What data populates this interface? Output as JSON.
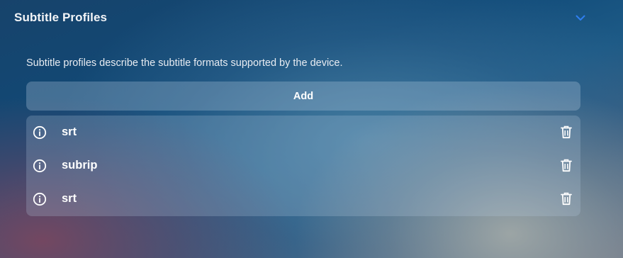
{
  "section": {
    "title": "Subtitle Profiles",
    "expand_icon": "chevron-down-icon",
    "accent_color": "#2f7ff0"
  },
  "description": "Subtitle profiles describe the subtitle formats supported by the device.",
  "add_button": {
    "label": "Add"
  },
  "profiles": [
    {
      "name": "srt",
      "info_icon": "info-icon",
      "delete_icon": "trash-icon"
    },
    {
      "name": "subrip",
      "info_icon": "info-icon",
      "delete_icon": "trash-icon"
    },
    {
      "name": "srt",
      "info_icon": "info-icon",
      "delete_icon": "trash-icon"
    }
  ]
}
